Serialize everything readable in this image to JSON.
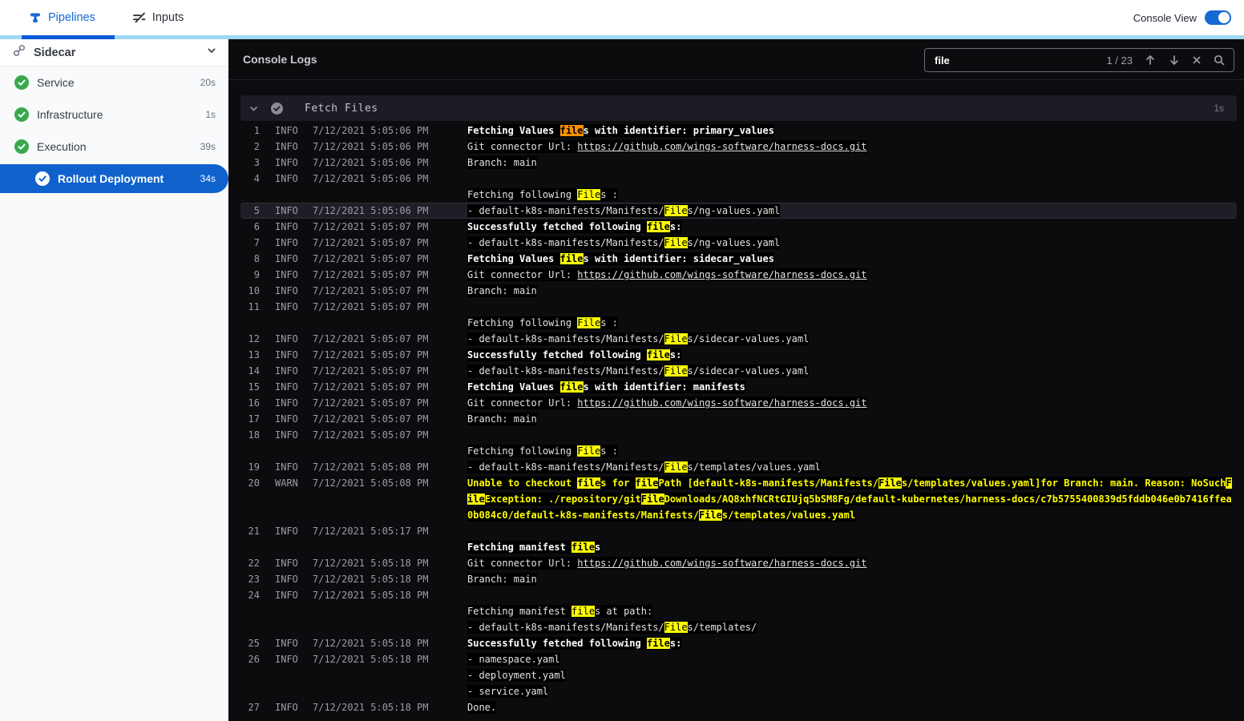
{
  "colors": {
    "accent_blue": "#1668d3",
    "selected_stage_blue": "#0f62cc",
    "success_green": "#3aa94e",
    "warn_text": "#ffff00",
    "match_highlight": "#fdfd00",
    "active_match_highlight": "#ff9100",
    "console_bg": "#0c0c0f"
  },
  "header": {
    "tabs": [
      {
        "label": "Pipelines",
        "active": true
      },
      {
        "label": "Inputs",
        "active": false
      }
    ],
    "console_view": {
      "label": "Console View",
      "enabled": true
    }
  },
  "sidebar": {
    "title": "Sidecar",
    "stages": [
      {
        "label": "Service",
        "duration": "20s",
        "status": "success",
        "selected": false
      },
      {
        "label": "Infrastructure",
        "duration": "1s",
        "status": "success",
        "selected": false
      },
      {
        "label": "Execution",
        "duration": "39s",
        "status": "success",
        "selected": false
      },
      {
        "label": "Rollout Deployment",
        "duration": "34s",
        "status": "success",
        "selected": true
      }
    ]
  },
  "console": {
    "title": "Console Logs",
    "search": {
      "query": "file",
      "counter": "1 / 23"
    },
    "section": {
      "title": "Fetch Files",
      "duration": "1s"
    },
    "logs": [
      {
        "num": "1",
        "level": "INFO",
        "time": "7/12/2021 5:05:06 PM",
        "style": "bold",
        "segments": [
          {
            "t": "Fetching Values "
          },
          {
            "t": "file",
            "m": "active"
          },
          {
            "t": "s with identifier: primary_values"
          }
        ]
      },
      {
        "num": "2",
        "level": "INFO",
        "time": "7/12/2021 5:05:06 PM",
        "segments": [
          {
            "t": "Git connector Url: "
          },
          {
            "t": "https://github.com/wings-software/harness-docs.git",
            "m": "link"
          }
        ]
      },
      {
        "num": "3",
        "level": "INFO",
        "time": "7/12/2021 5:05:06 PM",
        "segments": [
          {
            "t": "Branch: main"
          }
        ]
      },
      {
        "num": "4",
        "level": "INFO",
        "time": "7/12/2021 5:05:06 PM",
        "segments": []
      },
      {
        "num": "",
        "level": "",
        "time": "",
        "segments": [
          {
            "t": "Fetching following "
          },
          {
            "t": "File",
            "m": "match"
          },
          {
            "t": "s :"
          }
        ]
      },
      {
        "num": "5",
        "level": "INFO",
        "time": "7/12/2021 5:05:06 PM",
        "row_highlight": true,
        "segments": [
          {
            "t": "- default-k8s-manifests/Manifests/"
          },
          {
            "t": "File",
            "m": "match"
          },
          {
            "t": "s/ng-values.yaml"
          }
        ]
      },
      {
        "num": "6",
        "level": "INFO",
        "time": "7/12/2021 5:05:07 PM",
        "style": "bold",
        "segments": [
          {
            "t": "Successfully fetched following "
          },
          {
            "t": "file",
            "m": "match"
          },
          {
            "t": "s:"
          }
        ]
      },
      {
        "num": "7",
        "level": "INFO",
        "time": "7/12/2021 5:05:07 PM",
        "segments": [
          {
            "t": "- default-k8s-manifests/Manifests/"
          },
          {
            "t": "File",
            "m": "match"
          },
          {
            "t": "s/ng-values.yaml"
          }
        ]
      },
      {
        "num": "8",
        "level": "INFO",
        "time": "7/12/2021 5:05:07 PM",
        "style": "bold",
        "segments": [
          {
            "t": "Fetching Values "
          },
          {
            "t": "file",
            "m": "match"
          },
          {
            "t": "s with identifier: sidecar_values"
          }
        ]
      },
      {
        "num": "9",
        "level": "INFO",
        "time": "7/12/2021 5:05:07 PM",
        "segments": [
          {
            "t": "Git connector Url: "
          },
          {
            "t": "https://github.com/wings-software/harness-docs.git",
            "m": "link"
          }
        ]
      },
      {
        "num": "10",
        "level": "INFO",
        "time": "7/12/2021 5:05:07 PM",
        "segments": [
          {
            "t": "Branch: main"
          }
        ]
      },
      {
        "num": "11",
        "level": "INFO",
        "time": "7/12/2021 5:05:07 PM",
        "segments": []
      },
      {
        "num": "",
        "level": "",
        "time": "",
        "segments": [
          {
            "t": "Fetching following "
          },
          {
            "t": "File",
            "m": "match"
          },
          {
            "t": "s :"
          }
        ]
      },
      {
        "num": "12",
        "level": "INFO",
        "time": "7/12/2021 5:05:07 PM",
        "segments": [
          {
            "t": "- default-k8s-manifests/Manifests/"
          },
          {
            "t": "File",
            "m": "match"
          },
          {
            "t": "s/sidecar-values.yaml"
          }
        ]
      },
      {
        "num": "13",
        "level": "INFO",
        "time": "7/12/2021 5:05:07 PM",
        "style": "bold",
        "segments": [
          {
            "t": "Successfully fetched following "
          },
          {
            "t": "file",
            "m": "match"
          },
          {
            "t": "s:"
          }
        ]
      },
      {
        "num": "14",
        "level": "INFO",
        "time": "7/12/2021 5:05:07 PM",
        "segments": [
          {
            "t": "- default-k8s-manifests/Manifests/"
          },
          {
            "t": "File",
            "m": "match"
          },
          {
            "t": "s/sidecar-values.yaml"
          }
        ]
      },
      {
        "num": "15",
        "level": "INFO",
        "time": "7/12/2021 5:05:07 PM",
        "style": "bold",
        "segments": [
          {
            "t": "Fetching Values "
          },
          {
            "t": "file",
            "m": "match"
          },
          {
            "t": "s with identifier: manifests"
          }
        ]
      },
      {
        "num": "16",
        "level": "INFO",
        "time": "7/12/2021 5:05:07 PM",
        "segments": [
          {
            "t": "Git connector Url: "
          },
          {
            "t": "https://github.com/wings-software/harness-docs.git",
            "m": "link"
          }
        ]
      },
      {
        "num": "17",
        "level": "INFO",
        "time": "7/12/2021 5:05:07 PM",
        "segments": [
          {
            "t": "Branch: main"
          }
        ]
      },
      {
        "num": "18",
        "level": "INFO",
        "time": "7/12/2021 5:05:07 PM",
        "segments": []
      },
      {
        "num": "",
        "level": "",
        "time": "",
        "segments": [
          {
            "t": "Fetching following "
          },
          {
            "t": "File",
            "m": "match"
          },
          {
            "t": "s :"
          }
        ]
      },
      {
        "num": "19",
        "level": "INFO",
        "time": "7/12/2021 5:05:08 PM",
        "segments": [
          {
            "t": "- default-k8s-manifests/Manifests/"
          },
          {
            "t": "File",
            "m": "match"
          },
          {
            "t": "s/templates/values.yaml"
          }
        ]
      },
      {
        "num": "20",
        "level": "WARN",
        "time": "7/12/2021 5:05:08 PM",
        "style": "warn",
        "wrap": true,
        "segments": [
          {
            "t": "Unable to checkout "
          },
          {
            "t": "file",
            "m": "match"
          },
          {
            "t": "s for "
          },
          {
            "t": "file",
            "m": "match"
          },
          {
            "t": "Path [default-k8s-manifests/Manifests/"
          },
          {
            "t": "File",
            "m": "match"
          },
          {
            "t": "s/templates/values.yaml]for Branch: main. Reason: NoSuch"
          },
          {
            "t": "File",
            "m": "match"
          },
          {
            "t": "Exception: ./repository/git"
          },
          {
            "t": "File",
            "m": "match"
          },
          {
            "t": "Downloads/AQ8xhfNCRtGIUjq5bSM8Fg/default-kubernetes/harness-docs/c7b5755400839d5fddb046e0b7416ffea0b084c0/default-k8s-manifests/Manifests/"
          },
          {
            "t": "File",
            "m": "match"
          },
          {
            "t": "s/templates/values.yaml"
          }
        ]
      },
      {
        "num": "21",
        "level": "INFO",
        "time": "7/12/2021 5:05:17 PM",
        "segments": []
      },
      {
        "num": "",
        "level": "",
        "time": "",
        "style": "bold",
        "segments": [
          {
            "t": "Fetching manifest "
          },
          {
            "t": "file",
            "m": "match"
          },
          {
            "t": "s"
          }
        ]
      },
      {
        "num": "22",
        "level": "INFO",
        "time": "7/12/2021 5:05:18 PM",
        "segments": [
          {
            "t": "Git connector Url: "
          },
          {
            "t": "https://github.com/wings-software/harness-docs.git",
            "m": "link"
          }
        ]
      },
      {
        "num": "23",
        "level": "INFO",
        "time": "7/12/2021 5:05:18 PM",
        "segments": [
          {
            "t": "Branch: main"
          }
        ]
      },
      {
        "num": "24",
        "level": "INFO",
        "time": "7/12/2021 5:05:18 PM",
        "segments": []
      },
      {
        "num": "",
        "level": "",
        "time": "",
        "segments": [
          {
            "t": "Fetching manifest "
          },
          {
            "t": "file",
            "m": "match"
          },
          {
            "t": "s at path:"
          }
        ]
      },
      {
        "num": "",
        "level": "",
        "time": "",
        "segments": [
          {
            "t": "- default-k8s-manifests/Manifests/"
          },
          {
            "t": "File",
            "m": "match"
          },
          {
            "t": "s/templates/"
          }
        ]
      },
      {
        "num": "25",
        "level": "INFO",
        "time": "7/12/2021 5:05:18 PM",
        "style": "bold",
        "segments": [
          {
            "t": "Successfully fetched following "
          },
          {
            "t": "file",
            "m": "match"
          },
          {
            "t": "s:"
          }
        ]
      },
      {
        "num": "26",
        "level": "INFO",
        "time": "7/12/2021 5:05:18 PM",
        "segments": [
          {
            "t": "- namespace.yaml"
          }
        ]
      },
      {
        "num": "",
        "level": "",
        "time": "",
        "segments": [
          {
            "t": "- deployment.yaml"
          }
        ]
      },
      {
        "num": "",
        "level": "",
        "time": "",
        "segments": [
          {
            "t": "- service.yaml"
          }
        ]
      },
      {
        "num": "27",
        "level": "INFO",
        "time": "7/12/2021 5:05:18 PM",
        "segments": [
          {
            "t": "Done."
          }
        ]
      }
    ]
  }
}
